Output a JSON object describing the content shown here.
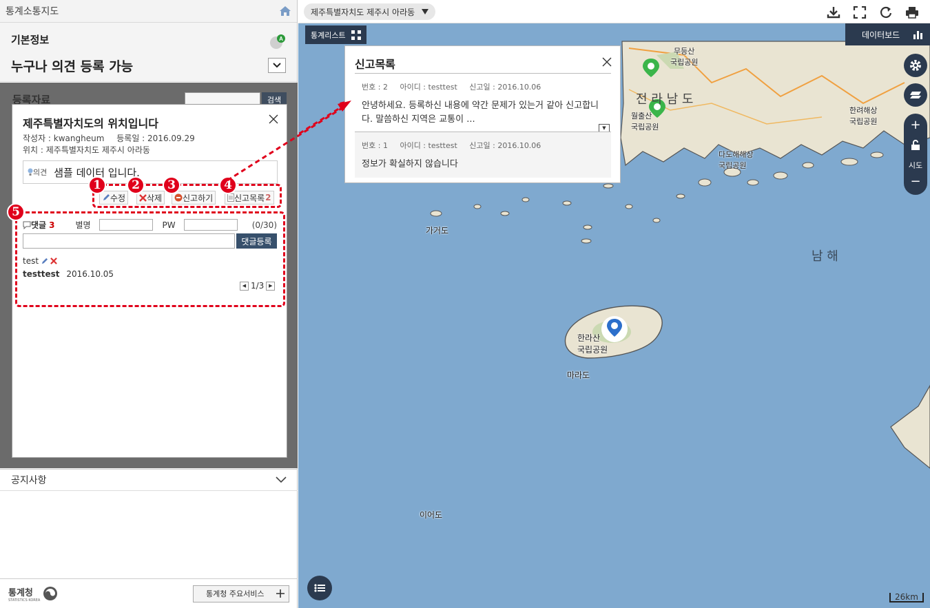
{
  "left": {
    "app_title": "통계소통지도",
    "basic_title": "기본정보",
    "basic_subtitle": "누구나 의견 등록 가능",
    "reg_title": "등록자료",
    "reg_search_btn": "검색",
    "notice": "공지사항",
    "logo_text": "통계청",
    "logo_sub": "STATISTICS KOREA",
    "service_btn": "통계청 주요서비스"
  },
  "popup": {
    "title": "제주특별자치도의 위치입니다",
    "author": "작성자 : kwangheum",
    "reg_date": "등록일 : 2016.09.29",
    "location": "위치 : 제주특별자치도 제주시 아라동",
    "opinion_label": "의견",
    "opinion_text": "샘플 데이터 입니다.",
    "btn_edit": "수정",
    "btn_delete": "삭제",
    "btn_report": "신고하기",
    "btn_report_list": "신고목록",
    "report_count": "2",
    "comment_label": "댓글",
    "comment_count": "3",
    "nick_label": "별명",
    "pw_label": "PW",
    "comment_limit": "(0/30)",
    "comment_submit": "댓글등록",
    "comment_text": "test",
    "comment_user": "testtest",
    "comment_date": "2016.10.05",
    "page": "1/3"
  },
  "annotations": [
    "1",
    "2",
    "3",
    "4",
    "5"
  ],
  "map": {
    "region": "제주특별자치도 제주시 아라동",
    "stat_list": "통계리스트",
    "dashboard": "데이터보드",
    "zoom_label": "시도",
    "scale": "26km",
    "labels": {
      "mudeungsan": "무등산\n국립공원",
      "jeonnam": "전 라 남 도",
      "wolchulsan": "월출산\n국립공원",
      "hallyeo": "한려해상\n국립공원",
      "dadohae": "다도해해상\n국립공원",
      "gageodo": "가거도",
      "namhae": "남 해",
      "hallasan": "한라산\n국립공원",
      "marado": "마라도",
      "ieodo": "이어도"
    }
  },
  "report": {
    "title": "신고목록",
    "items": [
      {
        "no": "번호 : 2",
        "id": "아이디 : testtest",
        "date": "신고일 : 2016.10.06",
        "body": "안녕하세요. 등록하신 내용에 약간 문제가 있는거 같아 신고합니다. 말씀하신 지역은 교통이 ..."
      },
      {
        "no": "번호 : 1",
        "id": "아이디 : testtest",
        "date": "신고일 : 2016.10.06",
        "body": "정보가 확실하지 않습니다"
      }
    ]
  },
  "colors": {
    "navy": "#2b3a4f",
    "annotation_red": "#e0001b",
    "sea": "#7fa9cf",
    "land": "#e9e4d2"
  }
}
